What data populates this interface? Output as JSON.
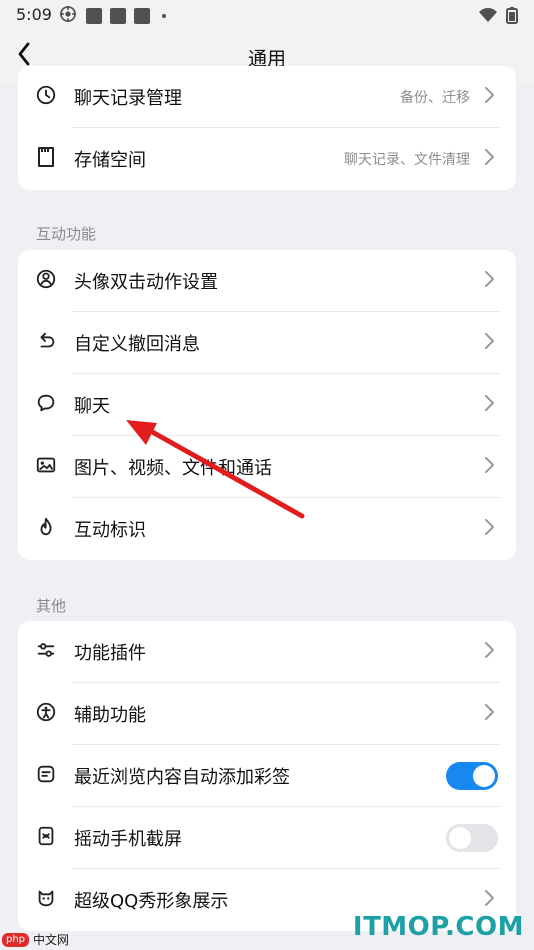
{
  "status_bar": {
    "time": "5:09",
    "icons": [
      "settings-icon",
      "square-icon",
      "square-icon",
      "square-icon",
      "dot-icon",
      "wifi-icon",
      "battery-icon"
    ]
  },
  "navbar": {
    "title": "通用",
    "back_icon": "chevron-left-icon"
  },
  "top_card": {
    "items": [
      {
        "label": "聊天记录管理",
        "value": "备份、迁移",
        "icon": "clock-icon"
      },
      {
        "label": "存储空间",
        "value": "聊天记录、文件清理",
        "icon": "storage-icon"
      }
    ]
  },
  "sections": [
    {
      "title": "互动功能",
      "items": [
        {
          "label": "头像双击动作设置",
          "icon": "user-circle-icon"
        },
        {
          "label": "自定义撤回消息",
          "icon": "undo-icon"
        },
        {
          "label": "聊天",
          "icon": "chat-bubble-icon"
        },
        {
          "label": "图片、视频、文件和通话",
          "icon": "image-icon"
        },
        {
          "label": "互动标识",
          "icon": "flame-icon"
        }
      ]
    },
    {
      "title": "其他",
      "items": [
        {
          "label": "功能插件",
          "icon": "sliders-icon"
        },
        {
          "label": "辅助功能",
          "icon": "accessibility-icon"
        },
        {
          "label": "最近浏览内容自动添加彩签",
          "icon": "tag-icon",
          "toggle": "on"
        },
        {
          "label": "摇动手机截屏",
          "icon": "phone-screenshot-icon",
          "toggle": "off"
        },
        {
          "label": "超级QQ秀形象展示",
          "icon": "mask-icon"
        }
      ]
    }
  ],
  "colors": {
    "toggle_on": "#1688f0",
    "toggle_off": "#e3e3e8",
    "arrow": "#e21d1d",
    "background": "#efeff4"
  },
  "watermarks": {
    "left_brand": "php",
    "left_text": "中文网",
    "right_text": "ITMOP.COM"
  }
}
